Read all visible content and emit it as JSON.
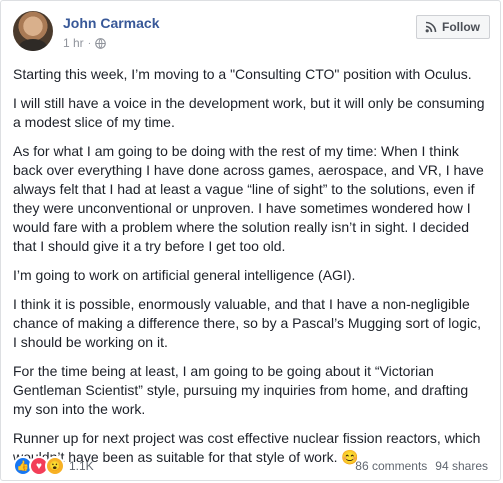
{
  "post": {
    "author": "John Carmack",
    "time": "1 hr",
    "separator": "·",
    "follow_label": "Follow",
    "paragraphs": [
      "Starting this week, I’m moving to a \"Consulting CTO\" position with Oculus.",
      "I will still have a voice in the development work, but it will only be consuming a modest slice of my time.",
      "As for what I am going to be doing with the rest of my time: When I think back over everything I have done across games, aerospace, and VR, I have always felt that I had at least a vague “line of sight” to the solutions, even if they were unconventional or unproven. I have sometimes wondered how I would fare with a problem where the solution really isn’t in sight. I decided that I should give it a try before I get too old.",
      "I’m going to work on artificial general intelligence (AGI).",
      "I think it is possible, enormously valuable, and that I have a non-negligible chance of making a difference there, so by a Pascal’s Mugging sort of logic, I should be working on it.",
      "For the time being at least, I am going to be going about it “Victorian Gentleman Scientist” style, pursuing my inquiries from home, and drafting my son into the work.",
      "Runner up for next project was cost effective nuclear fission reactors, which wouldn’t have been as suitable for that style of work. 😊"
    ]
  },
  "footer": {
    "reaction_icons": [
      "like-icon",
      "love-icon",
      "wow-icon"
    ],
    "reaction_count": "1.1K",
    "comments": "86 comments",
    "shares": "94 shares"
  },
  "colors": {
    "author": "#385898",
    "meta": "#90949c",
    "like": "#1877f2",
    "love": "#f33e58",
    "wow": "#f7b125"
  }
}
